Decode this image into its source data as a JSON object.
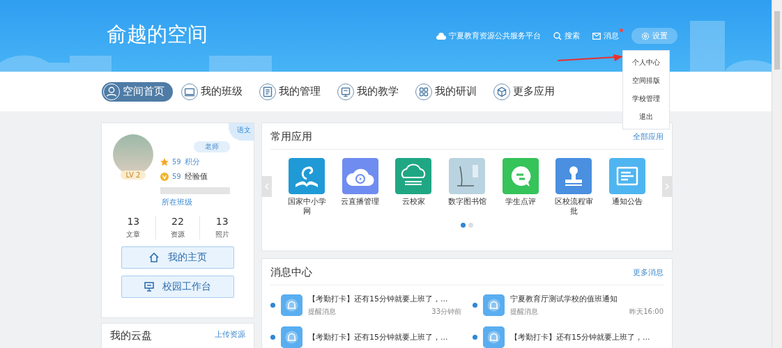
{
  "header": {
    "title": "俞越的空间",
    "platform_link": "宁夏教育资源公共服务平台",
    "search": "搜索",
    "messages": {
      "label": "消息",
      "unread": true
    },
    "settings": "设置"
  },
  "settings_menu": {
    "items": [
      {
        "label": "个人中心"
      },
      {
        "label": "空间排版"
      },
      {
        "label": "学校管理"
      },
      {
        "label": "退出"
      }
    ]
  },
  "nav": {
    "tabs": [
      {
        "label": "空间首页",
        "selected": true
      },
      {
        "label": "我的班级",
        "selected": false
      },
      {
        "label": "我的管理",
        "selected": false
      },
      {
        "label": "我的教学",
        "selected": false
      },
      {
        "label": "我的研训",
        "selected": false
      },
      {
        "label": "更多应用",
        "selected": false
      }
    ]
  },
  "profile": {
    "subject_tag": "语文",
    "role": "老师",
    "level": "LV 2",
    "points": {
      "value": "59",
      "label": "积分"
    },
    "experience": {
      "value": "59",
      "label": "经验值"
    },
    "class_link": "所在班级",
    "stats": [
      {
        "value": "13",
        "label": "文章"
      },
      {
        "value": "22",
        "label": "资源"
      },
      {
        "value": "13",
        "label": "照片"
      }
    ],
    "buttons": [
      {
        "label": "我的主页"
      },
      {
        "label": "校园工作台"
      }
    ]
  },
  "cloud": {
    "title": "我的云盘",
    "link": "上传资源"
  },
  "apps": {
    "title": "常用应用",
    "more": "全部应用",
    "items": [
      {
        "label": "国家中小学网",
        "color": "#1f9ad6"
      },
      {
        "label": "云直播管理",
        "color": "#6f8cf0"
      },
      {
        "label": "云校家",
        "color": "#1fa784"
      },
      {
        "label": "数字图书馆",
        "color": "#b9d3e0"
      },
      {
        "label": "学生点评",
        "color": "#35c35a"
      },
      {
        "label": "区校流程审批",
        "color": "#4a8fe0"
      },
      {
        "label": "通知公告",
        "color": "#4fb5f0"
      }
    ],
    "pages": [
      {
        "selected": true
      },
      {
        "selected": false
      }
    ]
  },
  "messages": {
    "title": "消息中心",
    "more": "更多消息",
    "items": [
      {
        "title": "【考勤打卡】还有15分钟就要上班了，...",
        "type": "提醒消息",
        "time": "33分钟前"
      },
      {
        "title": "宁夏教育厅测试学校的值班通知",
        "type": "提醒消息",
        "time": "昨天16:00"
      },
      {
        "title": "【考勤打卡】还有15分钟就要上班了，..."
      },
      {
        "title": "【考勤打卡】还有15分钟就要上班了，..."
      }
    ]
  }
}
